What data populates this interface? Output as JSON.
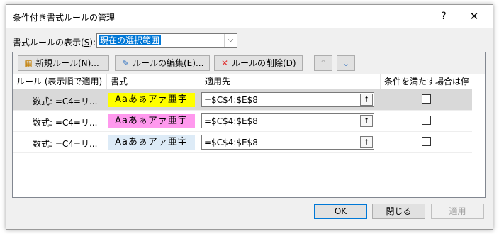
{
  "window": {
    "title": "条件付き書式ルールの管理",
    "help_glyph": "?",
    "close_glyph": "✕"
  },
  "scope": {
    "label_pre": "書式ルールの表示(",
    "label_key": "S",
    "label_post": "):",
    "selected": "現在の選択範囲",
    "dropdown_glyph": "⌵"
  },
  "toolbar": {
    "new_label": "新規ルール(N)...",
    "edit_label": "ルールの編集(E)...",
    "delete_label": "ルールの削除(D)",
    "up_glyph": "⌃",
    "down_glyph": "⌄"
  },
  "table": {
    "headers": {
      "rule": "ルール (表示順で適用)",
      "format": "書式",
      "applies_to": "適用先",
      "stop_if_true": "条件を満たす場合は停止"
    },
    "rows": [
      {
        "rule": "数式: =C4=リ...",
        "preview": "Aaあぁアァ亜宇",
        "applies_to": "=$C$4:$E$8",
        "stop": false,
        "selected": true,
        "bg": "#ffff00"
      },
      {
        "rule": "数式: =C4=リ...",
        "preview": "Aaあぁアァ亜宇",
        "applies_to": "=$C$4:$E$8",
        "stop": false,
        "selected": false,
        "bg": "#ff99ee"
      },
      {
        "rule": "数式: =C4=リ...",
        "preview": "Aaあぁアァ亜宇",
        "applies_to": "=$C$4:$E$8",
        "stop": false,
        "selected": false,
        "bg": "#ddebf7"
      }
    ],
    "ref_glyph": "⭡"
  },
  "footer": {
    "ok": "OK",
    "close": "閉じる",
    "apply": "適用"
  },
  "colors": {
    "accent": "#0078d7",
    "selected_row": "#d9d9d9"
  }
}
